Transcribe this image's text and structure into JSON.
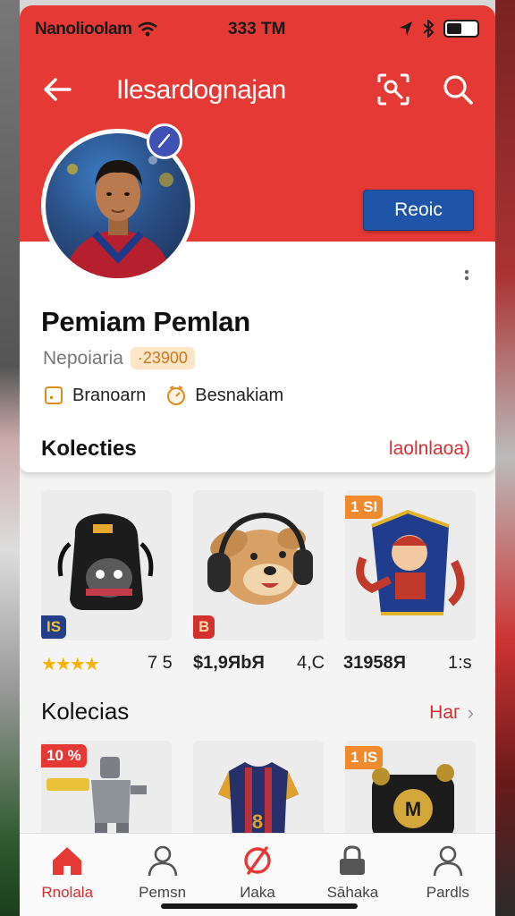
{
  "status_bar": {
    "carrier": "Nanolioolam",
    "time": "333 TM"
  },
  "app_bar": {
    "title": "Ilesardognajan",
    "back_icon": "arrow-left-icon",
    "qr_icon": "qr-scan-icon",
    "search_icon": "search-icon"
  },
  "profile": {
    "name": "Pemiam Pemlan",
    "subtitle": "Nepoiaria",
    "points": "·23900",
    "follow_label": "Reoic",
    "meta": [
      {
        "icon": "square-icon",
        "label": "Branoarn"
      },
      {
        "icon": "clock-icon",
        "label": "Besnakiam"
      }
    ]
  },
  "section1": {
    "title": "Kolecties",
    "link": "laolnlaoa)",
    "items": [
      {
        "name": "backpack",
        "tag": "IS"
      },
      {
        "name": "bear-headphones",
        "tag": "B"
      },
      {
        "name": "mascot-flag",
        "tag": "1 SI"
      }
    ],
    "prices": {
      "stars": "★★★★",
      "v1": "7 5",
      "v2": "$1,9ЯbЯ",
      "v3": "4,C",
      "v4": "31958Я",
      "v5": "1:s"
    }
  },
  "section2": {
    "title": "Kolecias",
    "link": "Haг",
    "items": [
      {
        "name": "figure",
        "tag": "10 %"
      },
      {
        "name": "jersey",
        "tag": ""
      },
      {
        "name": "gift-box",
        "tag": "1 IS"
      }
    ]
  },
  "bottom_nav": [
    {
      "label": "Rnolala",
      "icon": "home-icon",
      "active": true
    },
    {
      "label": "Pemsn",
      "icon": "person-icon",
      "active": false
    },
    {
      "label": "Иaka",
      "icon": "forbidden-icon",
      "active": false
    },
    {
      "label": "Sāhaka",
      "icon": "lock-icon",
      "active": false
    },
    {
      "label": "Pardls",
      "icon": "person-icon",
      "active": false
    }
  ],
  "colors": {
    "header_red": "#e53935",
    "follow_blue": "#1e55a8",
    "accent_red": "#d32f2f"
  }
}
